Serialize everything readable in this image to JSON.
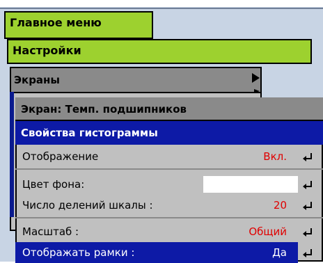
{
  "menus": {
    "main_menu": "Главное меню",
    "settings": "Настройки",
    "screens": "Экраны"
  },
  "screen_window": {
    "title": "Экран: Темп. подшипников"
  },
  "histogram_panel": {
    "title": "Свойства гистограммы",
    "rows": [
      {
        "label": "Отображение",
        "value": "Вкл."
      },
      {
        "label": "Цвет фона:",
        "value": ""
      },
      {
        "label": "Число делений шкалы :",
        "value": "20"
      },
      {
        "label": "Масштаб :",
        "value": "Общий"
      },
      {
        "label": "Отображать рамки :",
        "value": "Да"
      }
    ]
  },
  "colors": {
    "accent_green": "#9dd12f",
    "selection_blue": "#0d1aa6",
    "value_red": "#e00000",
    "window_gray": "#c0c0c0"
  }
}
